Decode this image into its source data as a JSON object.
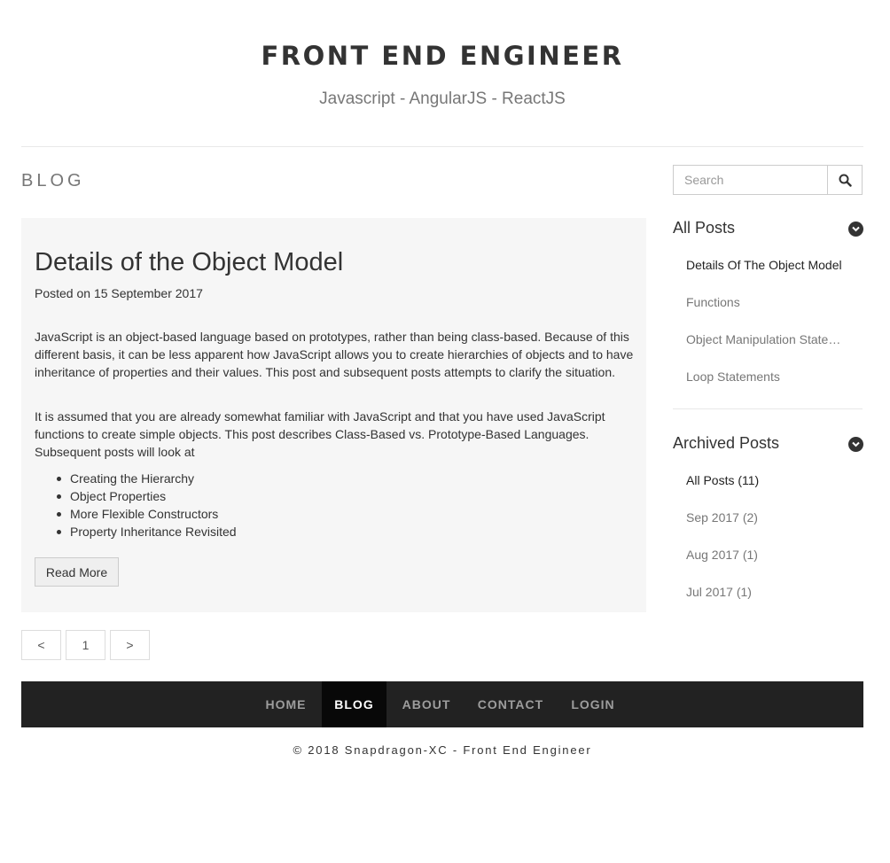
{
  "header": {
    "title": "FRONT END ENGINEER",
    "subtitle": "Javascript - AngularJS - ReactJS"
  },
  "main": {
    "section_title": "BLOG",
    "post": {
      "title": "Details of the Object Model",
      "date": "Posted on 15 September 2017",
      "paragraph1": "JavaScript is an object-based language based on prototypes, rather than being class-based. Because of this different basis, it can be less apparent how JavaScript allows you to create hierarchies of objects and to have inheritance of properties and their values. This post and subsequent posts attempts to clarify the situation.",
      "paragraph2": "It is assumed that you are already somewhat familiar with JavaScript and that you have used JavaScript functions to create simple objects. This post describes Class-Based vs. Prototype-Based Languages. Subsequent posts will look at",
      "list": [
        "Creating the Hierarchy",
        "Object Properties",
        "More Flexible Constructors",
        "Property Inheritance Revisited"
      ],
      "read_more_label": "Read More"
    },
    "pagination": {
      "prev_label": "<",
      "page_label": "1",
      "next_label": ">"
    }
  },
  "sidebar": {
    "search_placeholder": "Search",
    "all_posts": {
      "heading": "All Posts",
      "items": [
        "Details Of The Object Model",
        "Functions",
        "Object Manipulation Statements",
        "Loop Statements"
      ]
    },
    "archived_posts": {
      "heading": "Archived Posts",
      "items": [
        "All Posts (11)",
        "Sep 2017 (2)",
        "Aug 2017 (1)",
        "Jul 2017 (1)"
      ]
    }
  },
  "footer": {
    "nav": [
      "HOME",
      "BLOG",
      "ABOUT",
      "CONTACT",
      "LOGIN"
    ],
    "active_nav": "BLOG",
    "copyright": "© 2018 Snapdragon-XC - Front End Engineer"
  },
  "icons": {
    "search": "search-icon",
    "chevron": "chevron-down-icon"
  },
  "colors": {
    "text": "#333333",
    "muted": "#777777",
    "card_bg": "#f6f6f6",
    "nav_bg": "#222222",
    "nav_active_bg": "#080808"
  }
}
